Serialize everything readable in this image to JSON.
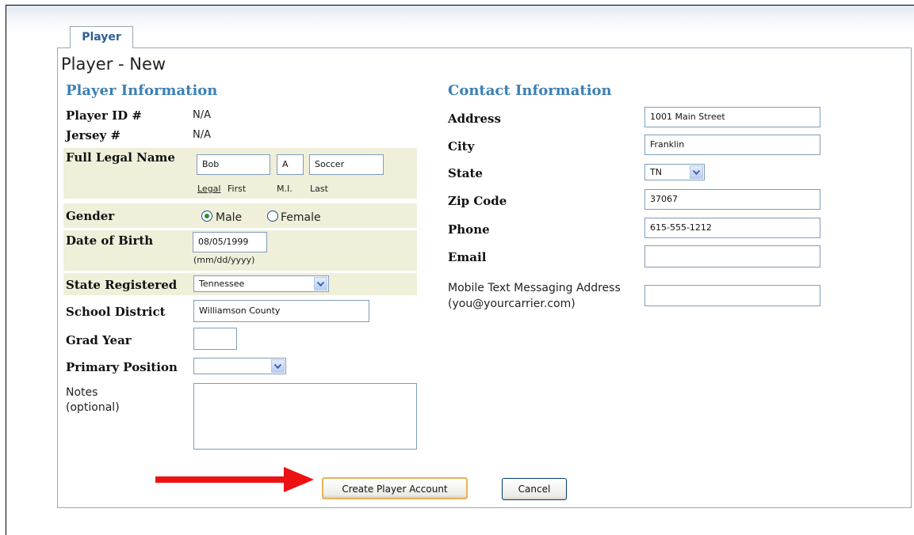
{
  "tab": {
    "label": "Player"
  },
  "page_title": "Player - New",
  "player_info": {
    "heading": "Player Information",
    "player_id": {
      "label": "Player ID #",
      "value": "N/A"
    },
    "jersey": {
      "label": "Jersey #",
      "value": "N/A"
    },
    "full_name": {
      "label": "Full Legal Name",
      "first": "Bob",
      "mi": "A",
      "last": "Soccer",
      "sub_legal": "Legal",
      "sub_first": "First",
      "sub_mi": "M.I.",
      "sub_last": "Last"
    },
    "gender": {
      "label": "Gender",
      "male": "Male",
      "female": "Female",
      "selected": "Male"
    },
    "dob": {
      "label": "Date of Birth",
      "value": "08/05/1999",
      "hint": "(mm/dd/yyyy)"
    },
    "state_registered": {
      "label": "State Registered",
      "value": "Tennessee"
    },
    "school_district": {
      "label": "School District",
      "value": "Williamson County"
    },
    "grad_year": {
      "label": "Grad Year",
      "value": ""
    },
    "primary_position": {
      "label": "Primary Position",
      "value": ""
    },
    "notes": {
      "label": "Notes",
      "label2": "(optional)",
      "value": ""
    }
  },
  "contact_info": {
    "heading": "Contact Information",
    "address": {
      "label": "Address",
      "value": "1001 Main Street"
    },
    "city": {
      "label": "City",
      "value": "Franklin"
    },
    "state": {
      "label": "State",
      "value": "TN"
    },
    "zip": {
      "label": "Zip Code",
      "value": "37067"
    },
    "phone": {
      "label": "Phone",
      "value": "615-555-1212"
    },
    "email": {
      "label": "Email",
      "value": ""
    },
    "mobile": {
      "label": "Mobile Text Messaging Address",
      "label2": "(you@yourcarrier.com)",
      "value": ""
    }
  },
  "actions": {
    "create_label": "Create Player Account",
    "cancel_label": "Cancel"
  },
  "colors": {
    "heading": "#3d80b5",
    "highlight": "#efefda",
    "annotation_arrow": "#ee1111"
  }
}
